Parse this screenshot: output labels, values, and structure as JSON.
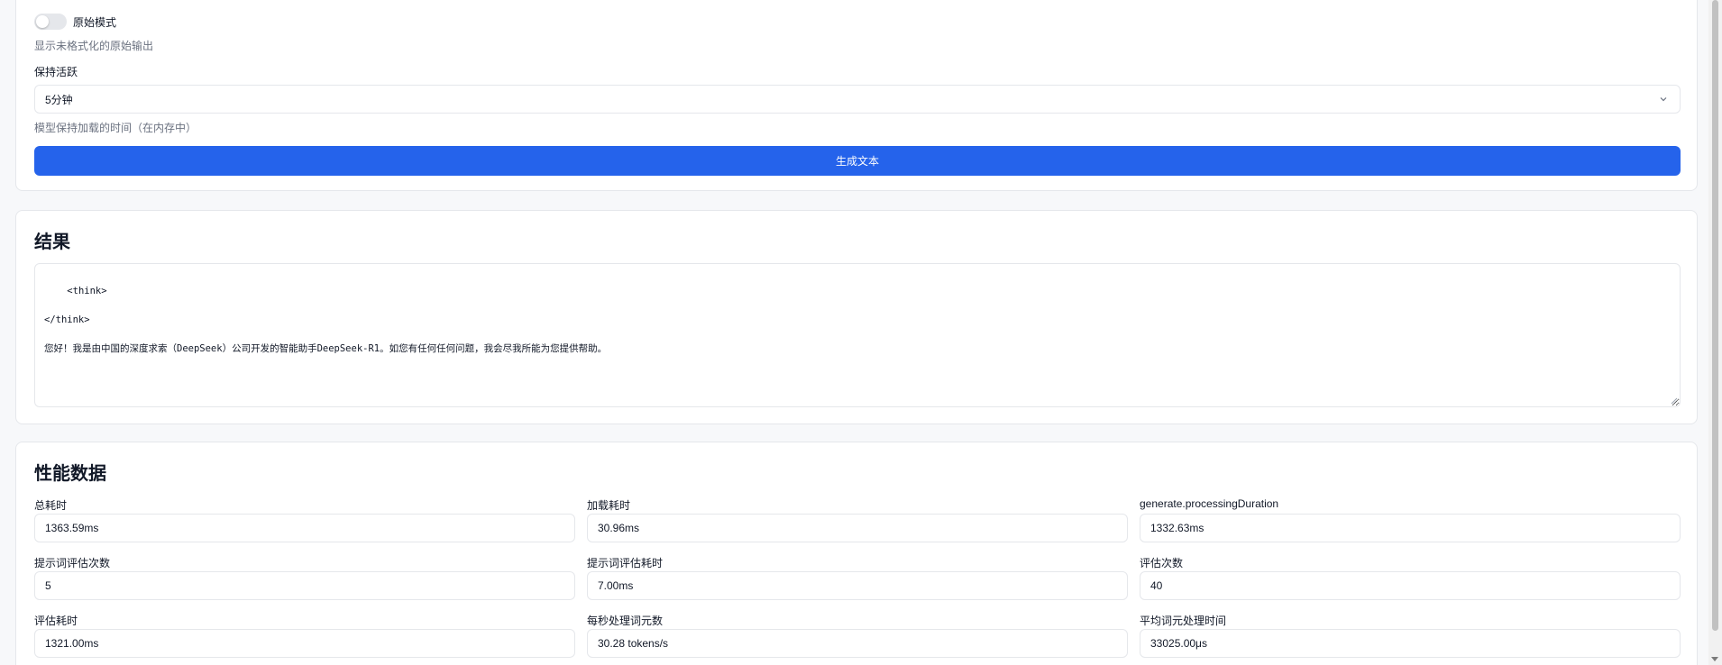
{
  "settings": {
    "raw_mode_label": "原始模式",
    "raw_mode_hint": "显示未格式化的原始输出",
    "keep_alive_label": "保持活跃",
    "keep_alive_value": "5分钟",
    "keep_alive_hint": "模型保持加载的时间（在内存中）",
    "generate_button": "生成文本"
  },
  "result": {
    "title": "结果",
    "text": "<think>\n\n</think>\n\n您好！我是由中国的深度求索（DeepSeek）公司开发的智能助手DeepSeek-R1。如您有任何任何问题，我会尽我所能为您提供帮助。"
  },
  "performance": {
    "title": "性能数据",
    "metrics": [
      {
        "label": "总耗时",
        "value": "1363.59ms"
      },
      {
        "label": "加载耗时",
        "value": "30.96ms"
      },
      {
        "label": "generate.processingDuration",
        "value": "1332.63ms"
      },
      {
        "label": "提示词评估次数",
        "value": "5"
      },
      {
        "label": "提示词评估耗时",
        "value": "7.00ms"
      },
      {
        "label": "评估次数",
        "value": "40"
      },
      {
        "label": "评估耗时",
        "value": "1321.00ms"
      },
      {
        "label": "每秒处理词元数",
        "value": "30.28 tokens/s"
      },
      {
        "label": "平均词元处理时间",
        "value": "33025.00μs"
      }
    ]
  },
  "colors": {
    "primary": "#2563eb",
    "border": "#e5e7eb",
    "background": "#f7f8fa"
  }
}
